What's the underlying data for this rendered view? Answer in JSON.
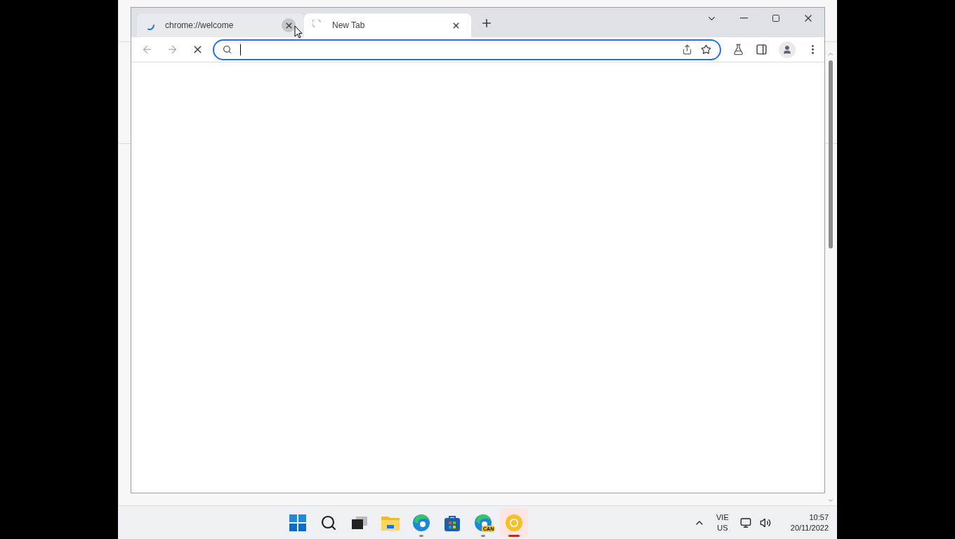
{
  "browser": {
    "tabs": [
      {
        "title": "chrome://welcome",
        "selected": false,
        "loading": true
      },
      {
        "title": "New Tab",
        "selected": true,
        "loading": true
      }
    ],
    "page_loading": true,
    "address_focused": true
  },
  "taskbar": {
    "apps": [
      {
        "kind": "start",
        "running": false,
        "active": false
      },
      {
        "kind": "search",
        "running": false,
        "active": false
      },
      {
        "kind": "task-view",
        "running": false,
        "active": false
      },
      {
        "kind": "folder",
        "running": false,
        "active": false
      },
      {
        "kind": "edge",
        "running": true,
        "active": false
      },
      {
        "kind": "store",
        "running": false,
        "active": false
      },
      {
        "kind": "edge",
        "running": true,
        "active": false,
        "badge": "CAN"
      },
      {
        "kind": "chrome",
        "running": true,
        "active": true
      }
    ],
    "language": {
      "line1": "VIE",
      "line2": "US"
    },
    "clock": {
      "time": "10:57",
      "date": "20/11/2022"
    }
  }
}
